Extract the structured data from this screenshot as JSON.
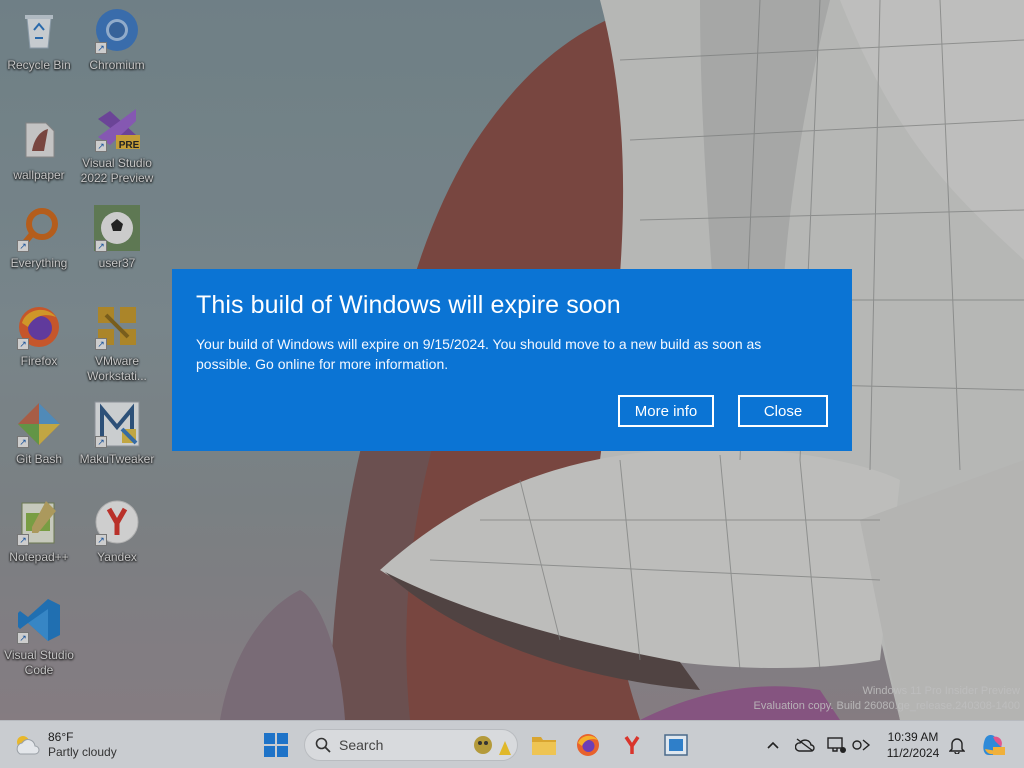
{
  "desktop": {
    "icons": [
      {
        "label": "Recycle Bin"
      },
      {
        "label": "Chromium"
      },
      {
        "label": "wallpaper"
      },
      {
        "label": "Visual Studio 2022 Preview"
      },
      {
        "label": "Everything"
      },
      {
        "label": "user37"
      },
      {
        "label": "Firefox"
      },
      {
        "label": "VMware Workstati..."
      },
      {
        "label": "Git Bash"
      },
      {
        "label": "MakuTweaker"
      },
      {
        "label": "Notepad++"
      },
      {
        "label": "Yandex"
      },
      {
        "label": "Visual Studio Code"
      }
    ],
    "vs_badge": "PRE"
  },
  "dialog": {
    "title": "This build of Windows will expire soon",
    "message": "Your build of Windows will expire on 9/15/2024. You should move to a new build as soon as possible. Go online for more information.",
    "more_info_label": "More info",
    "close_label": "Close",
    "background_color": "#0b74d4"
  },
  "watermark": {
    "line1": "Windows 11 Pro Insider Preview",
    "line2": "Evaluation copy. Build 26080.ge_release.240308-1400"
  },
  "taskbar": {
    "weather": {
      "temperature": "86°F",
      "condition": "Partly cloudy"
    },
    "search_placeholder": "Search",
    "clock": {
      "time": "10:39 AM",
      "date": "11/2/2024"
    },
    "pinned": [
      "start-icon",
      "file-explorer-icon",
      "firefox-icon",
      "yandex-icon",
      "app-window-icon"
    ]
  }
}
